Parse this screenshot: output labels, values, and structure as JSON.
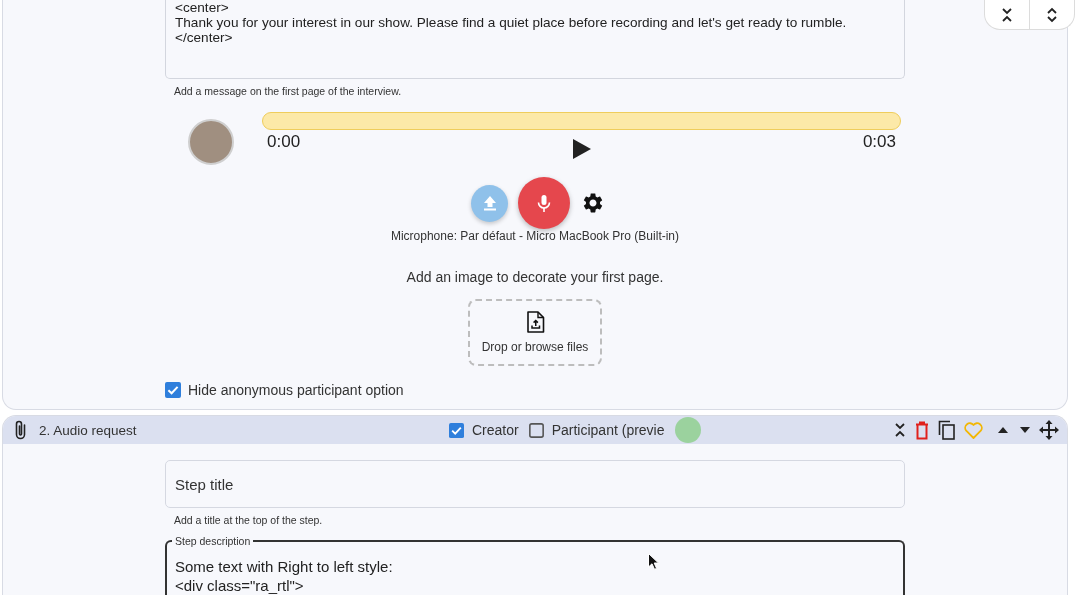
{
  "welcome_step": {
    "message": {
      "value": "<center>\nThank you for your interest in our show. Please find a quiet place before recording and let's get ready to rumble.\n</center>",
      "helper": "Add a message on the first page of the interview."
    },
    "audio": {
      "start_time": "0:00",
      "end_time": "0:03"
    },
    "microphone_label": "Microphone: Par défaut - Micro MacBook Pro (Built-in)",
    "image": {
      "prompt": "Add an image to decorate your first page.",
      "dropzone": "Drop or browse files"
    },
    "hide_anonymous": {
      "label": "Hide anonymous participant option",
      "checked": true
    }
  },
  "audio_step": {
    "title": "2. Audio request",
    "roles": [
      {
        "label": "Creator",
        "checked": true
      },
      {
        "label": "Participant (previe",
        "checked": false
      }
    ],
    "step_title": {
      "placeholder": "Step title",
      "helper": "Add a title at the top of the step."
    },
    "step_description": {
      "label": "Step description",
      "value": "Some text with Right to left style:\n<div class=\"ra_rtl\">"
    }
  }
}
